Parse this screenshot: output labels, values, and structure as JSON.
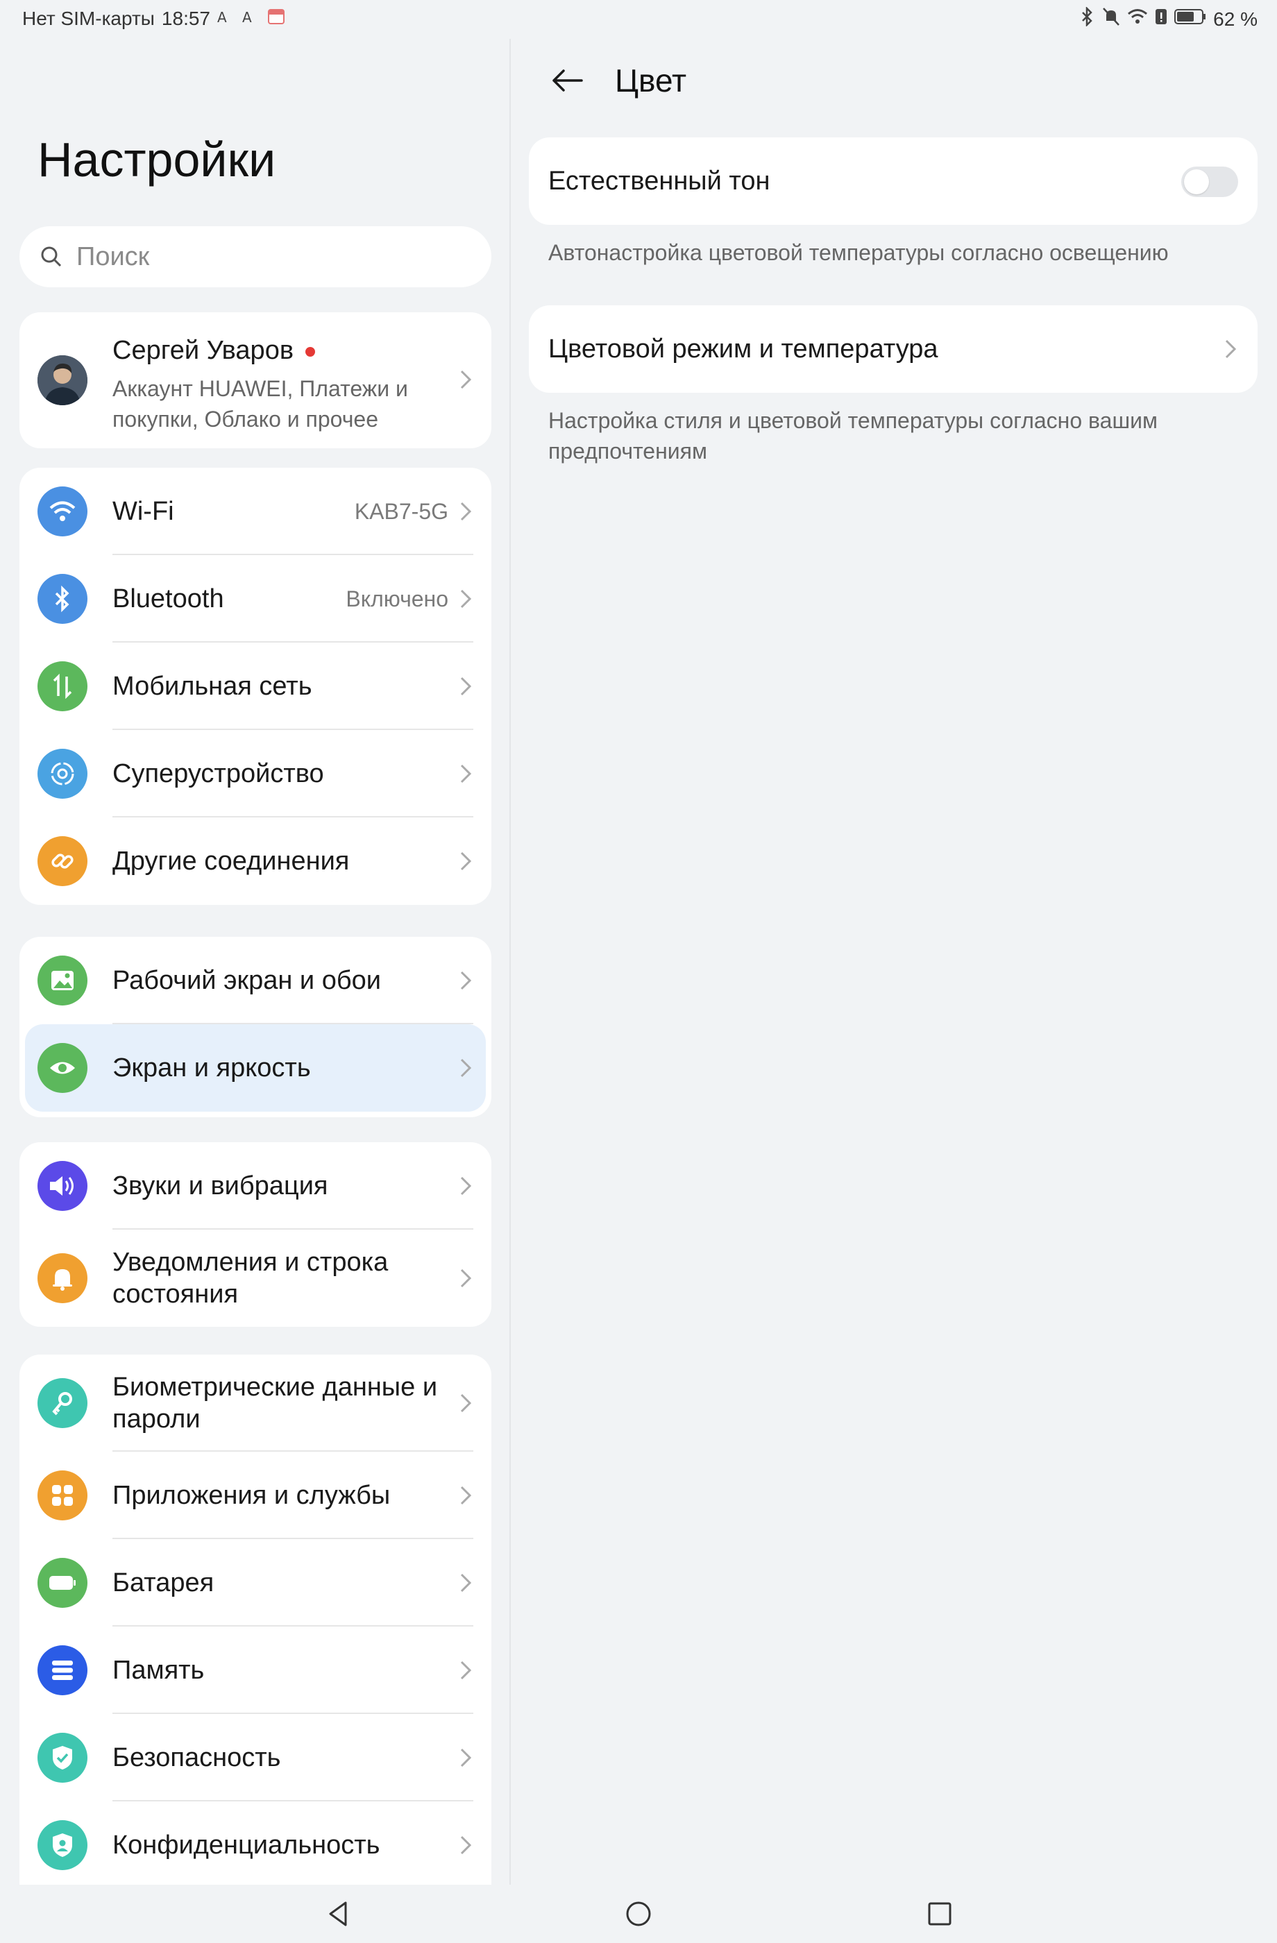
{
  "status_bar": {
    "carrier": "Нет SIM-карты",
    "time": "18:57",
    "battery": "62 %"
  },
  "left": {
    "title": "Настройки",
    "search_placeholder": "Поиск",
    "profile": {
      "name": "Сергей Уваров",
      "subtitle": "Аккаунт HUAWEI, Платежи и покупки, Облако и прочее"
    },
    "group1": [
      {
        "label": "Wi-Fi",
        "value": "KAB7-5G",
        "icon": "wifi-icon",
        "color": "#4a90e2"
      },
      {
        "label": "Bluetooth",
        "value": "Включено",
        "icon": "bluetooth-icon",
        "color": "#4a90e2"
      },
      {
        "label": "Мобильная сеть",
        "value": "",
        "icon": "mobile-network-icon",
        "color": "#5cb85c"
      },
      {
        "label": "Суперустройство",
        "value": "",
        "icon": "super-device-icon",
        "color": "#4aa3e2"
      },
      {
        "label": "Другие соединения",
        "value": "",
        "icon": "link-icon",
        "color": "#f0a030"
      }
    ],
    "group2": [
      {
        "label": "Рабочий экран и обои",
        "icon": "wallpaper-icon",
        "color": "#5cb85c"
      },
      {
        "label": "Экран и яркость",
        "icon": "eye-icon",
        "color": "#5cb85c"
      }
    ],
    "group3": [
      {
        "label": "Звуки и вибрация",
        "icon": "sound-icon",
        "color": "#5b4ae8"
      },
      {
        "label": "Уведомления и строка состояния",
        "icon": "bell-icon",
        "color": "#f0a030"
      }
    ],
    "group4": [
      {
        "label": "Биометрические данные и пароли",
        "icon": "key-icon",
        "color": "#3fc6b0"
      },
      {
        "label": "Приложения и службы",
        "icon": "apps-icon",
        "color": "#f0a030"
      },
      {
        "label": "Батарея",
        "icon": "battery-icon",
        "color": "#5cb85c"
      },
      {
        "label": "Память",
        "icon": "storage-icon",
        "color": "#2b5ce6"
      },
      {
        "label": "Безопасность",
        "icon": "shield-icon",
        "color": "#3fc6b0"
      },
      {
        "label": "Конфиденциальность",
        "icon": "privacy-icon",
        "color": "#3fc6b0"
      }
    ]
  },
  "right": {
    "title": "Цвет",
    "natural_tone": {
      "label": "Естественный тон",
      "description": "Автонастройка цветовой температуры согласно освещению",
      "enabled": false
    },
    "color_mode": {
      "label": "Цветовой режим и температура",
      "description": "Настройка стиля и цветовой температуры согласно вашим предпочтениям"
    }
  },
  "colors": {
    "accent_active_bg": "#e6f0fb",
    "background": "#f1f3f5"
  }
}
